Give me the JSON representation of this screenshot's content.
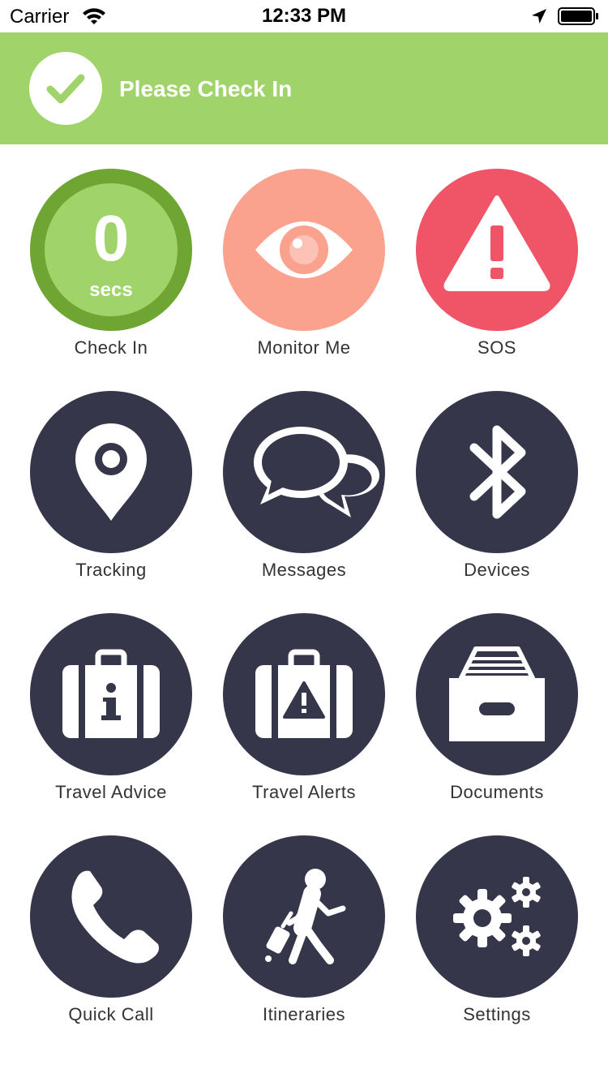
{
  "status_bar": {
    "carrier": "Carrier",
    "time": "12:33 PM",
    "icons": [
      "wifi-icon",
      "location-arrow-icon",
      "battery-icon"
    ]
  },
  "banner": {
    "title": "Please Check In",
    "icon": "checkmark-icon",
    "color": "#a0d46a"
  },
  "check_in": {
    "count": "0",
    "unit": "secs",
    "label": "Check In"
  },
  "tiles": {
    "monitor": {
      "label": "Monitor Me",
      "icon": "eye-icon",
      "color": "#fba28f"
    },
    "sos": {
      "label": "SOS",
      "icon": "warning-icon",
      "color": "#ef5567"
    },
    "tracking": {
      "label": "Tracking",
      "icon": "map-pin-icon"
    },
    "messages": {
      "label": "Messages",
      "icon": "chat-bubbles-icon"
    },
    "devices": {
      "label": "Devices",
      "icon": "bluetooth-icon"
    },
    "travel_advice": {
      "label": "Travel Advice",
      "icon": "suitcase-info-icon"
    },
    "travel_alerts": {
      "label": "Travel Alerts",
      "icon": "suitcase-alert-icon"
    },
    "documents": {
      "label": "Documents",
      "icon": "archive-box-icon"
    },
    "quick_call": {
      "label": "Quick Call",
      "icon": "phone-icon"
    },
    "itineraries": {
      "label": "Itineraries",
      "icon": "traveler-icon"
    },
    "settings": {
      "label": "Settings",
      "icon": "gears-icon"
    }
  },
  "colors": {
    "dark_tile": "#353649",
    "check_in_ring": "#6fa532"
  }
}
